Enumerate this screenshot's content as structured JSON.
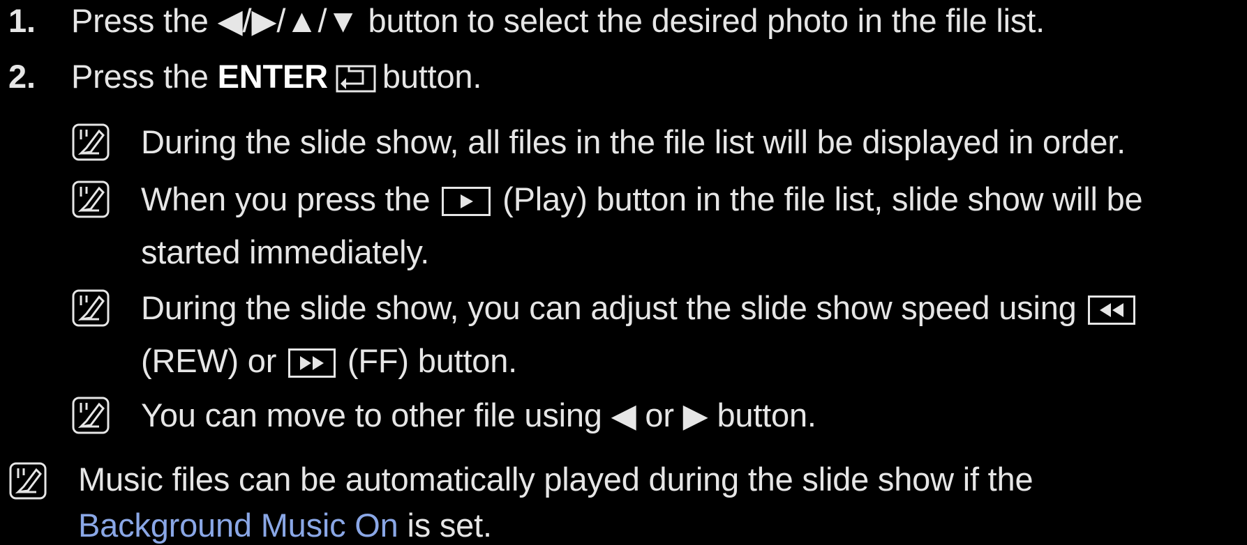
{
  "steps": [
    {
      "num": "1.",
      "text": "Press the ◀/▶/▲/▼ button to select the desired photo in the file list."
    },
    {
      "num": "2.",
      "pre": "Press the ",
      "bold": "ENTER",
      "post": "button."
    }
  ],
  "notes": [
    {
      "text": "During the slide show, all files in the file list will be displayed in order."
    },
    {
      "pre": "When you press the",
      "btn": "play-box",
      "post": "(Play) button in the file list, slide show will be",
      "cont": "started immediately."
    },
    {
      "pre": "During the slide show, you can adjust the slide show speed using",
      "cont_post": "(REW) or",
      "cont_end": "(FF) button."
    },
    {
      "text": "You can move to other file using ◀ or ▶ button."
    }
  ],
  "final_note": {
    "line1": "Music files can be automatically played during the slide show if the",
    "link": "Background Music On",
    "line2_post": " is set."
  },
  "colors": {
    "text": "#e6e6e6",
    "link": "#8aa7e6",
    "background": "#000000"
  },
  "icons": [
    "note-icon",
    "enter-icon",
    "play-icon",
    "rewind-icon",
    "fast-forward-icon"
  ]
}
